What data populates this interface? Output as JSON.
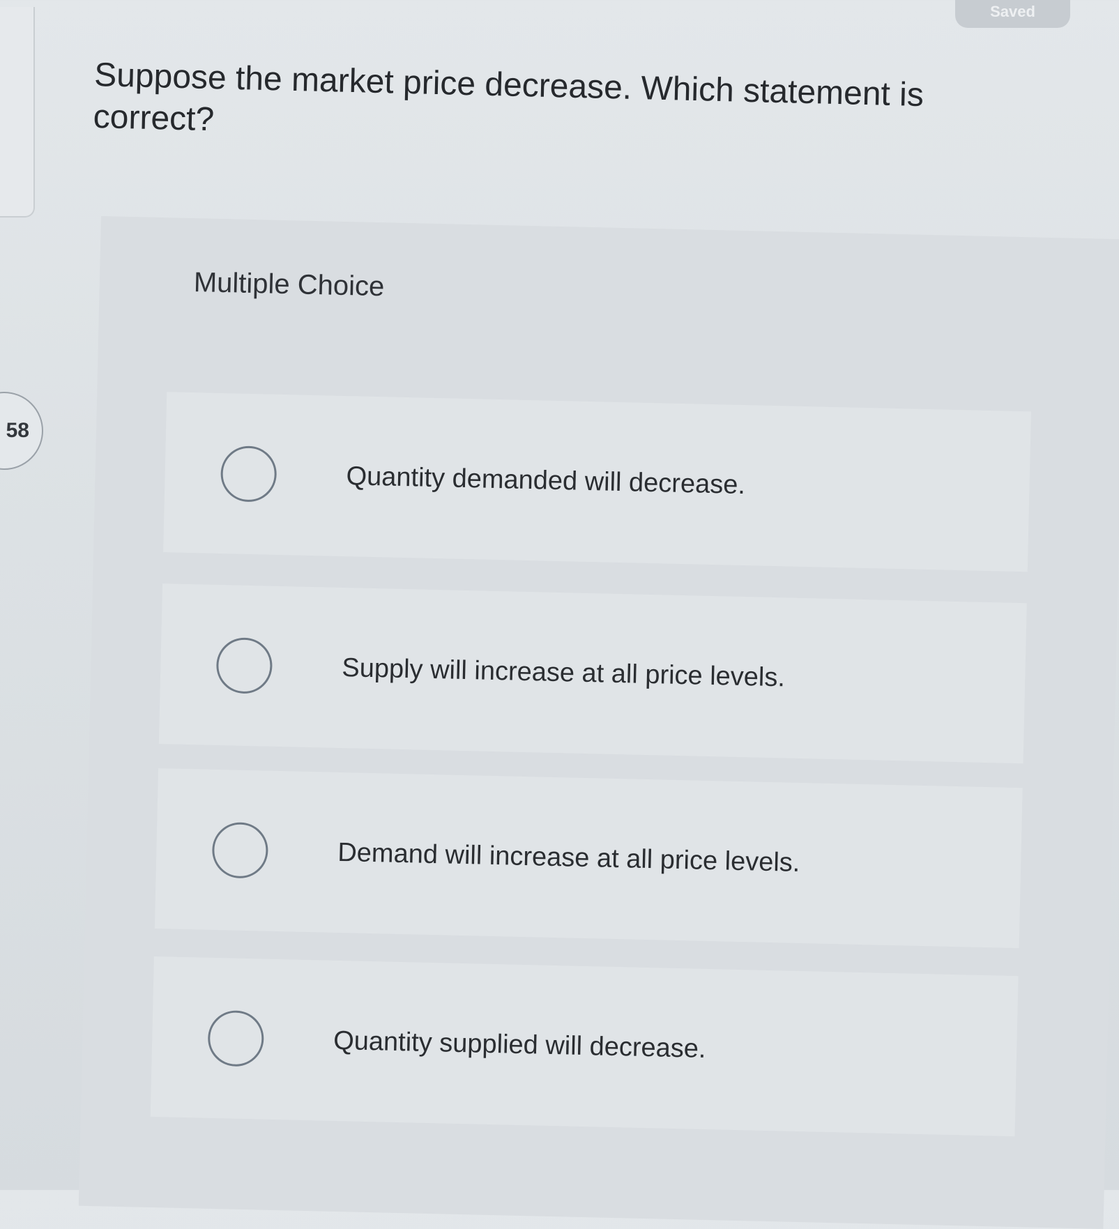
{
  "status": {
    "saved_label": "Saved"
  },
  "question": {
    "number": "58",
    "prompt": "Suppose the market price decrease. Which statement is correct?",
    "type_label": "Multiple Choice",
    "options": [
      {
        "label": "Quantity demanded will decrease."
      },
      {
        "label": "Supply will increase at all price levels."
      },
      {
        "label": "Demand will increase at all price levels."
      },
      {
        "label": "Quantity supplied will decrease."
      }
    ]
  }
}
